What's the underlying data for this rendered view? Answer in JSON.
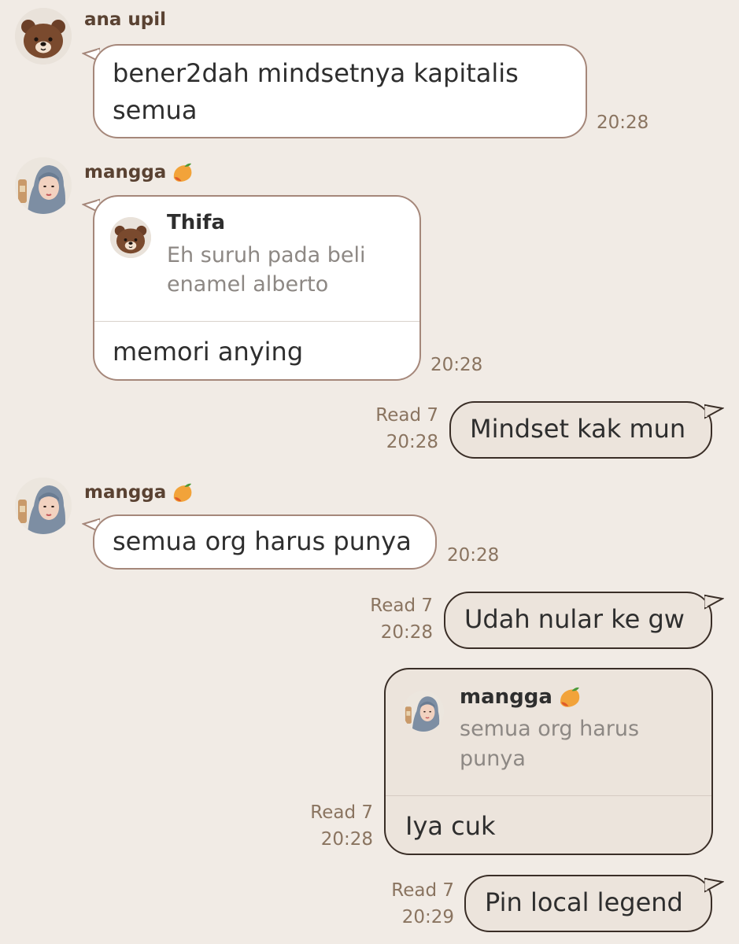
{
  "messages": [
    {
      "sender": "ana upil",
      "avatar_icon": "brown-bear-icon",
      "lines": [
        "bener2dah mindsetnya kapitalis",
        "semua"
      ],
      "time": "20:28"
    },
    {
      "sender": "mangga",
      "sender_emoji": "mango-emoji",
      "avatar_icon": "hijab-girl-avatar",
      "reply": {
        "name": "Thifa",
        "avatar_icon": "brown-bear-icon",
        "lines": [
          "Eh suruh pada beli",
          "enamel alberto"
        ]
      },
      "text": "memori anying",
      "time": "20:28"
    },
    {
      "outgoing": true,
      "text": "Mindset kak mun",
      "read": "Read 7",
      "time": "20:28"
    },
    {
      "sender": "mangga",
      "sender_emoji": "mango-emoji",
      "avatar_icon": "hijab-girl-avatar",
      "text": "semua org harus punya",
      "time": "20:28"
    },
    {
      "outgoing": true,
      "text": "Udah nular ke gw",
      "read": "Read 7",
      "time": "20:28"
    },
    {
      "outgoing": true,
      "reply": {
        "name": "mangga",
        "name_emoji": "mango-emoji",
        "avatar_icon": "hijab-girl-avatar",
        "lines": [
          "semua org harus",
          "punya"
        ]
      },
      "text": "Iya cuk",
      "read": "Read 7",
      "time": "20:28"
    },
    {
      "outgoing": true,
      "text": "Pin local legend",
      "read": "Read 7",
      "time": "20:29"
    }
  ],
  "colors": {
    "background": "#f1ebe5",
    "incoming_bubble": "#ffffff",
    "incoming_border": "#a5877a",
    "outgoing_bubble": "#ece4dc",
    "outgoing_border": "#3a2e27",
    "sender_name": "#5a4232",
    "meta": "#8a7460"
  }
}
